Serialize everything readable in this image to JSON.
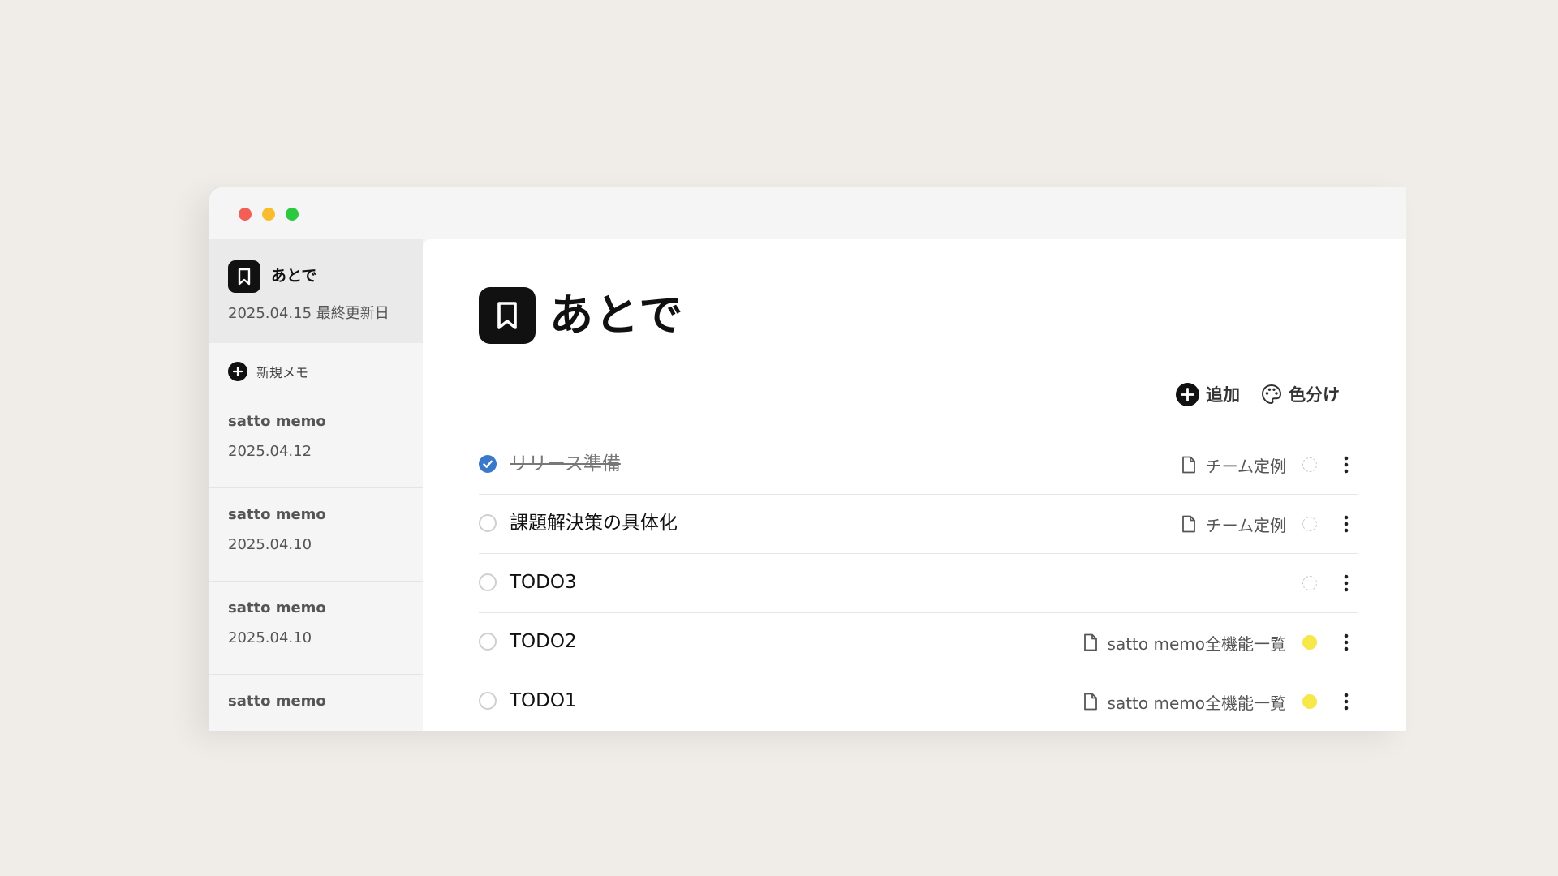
{
  "sidebar": {
    "current": {
      "title": "あとで",
      "date": "2025.04.15 最終更新日",
      "icon": "bookmark-icon"
    },
    "new_memo_label": "新規メモ",
    "items": [
      {
        "name": "satto memo",
        "date": "2025.04.12"
      },
      {
        "name": "satto memo",
        "date": "2025.04.10"
      },
      {
        "name": "satto memo",
        "date": "2025.04.10"
      },
      {
        "name": "satto memo",
        "date": ""
      }
    ]
  },
  "main": {
    "title": "あとで",
    "icon": "bookmark-icon",
    "toolbar": {
      "add_label": "追加",
      "color_label": "色分け"
    },
    "todos": [
      {
        "text": "リリース準備",
        "done": true,
        "doc": "チーム定例",
        "color": "none"
      },
      {
        "text": "課題解決策の具体化",
        "done": false,
        "doc": "チーム定例",
        "color": "none"
      },
      {
        "text": "TODO3",
        "done": false,
        "doc": "",
        "color": "none"
      },
      {
        "text": "TODO2",
        "done": false,
        "doc": "satto memo全機能一覧",
        "color": "#f6e84a"
      },
      {
        "text": "TODO1",
        "done": false,
        "doc": "satto memo全機能一覧",
        "color": "#f6e84a"
      }
    ]
  },
  "colors": {
    "check_done": "#3a78c9",
    "yellow_tag": "#f6e84a",
    "background": "#f0ece8"
  }
}
